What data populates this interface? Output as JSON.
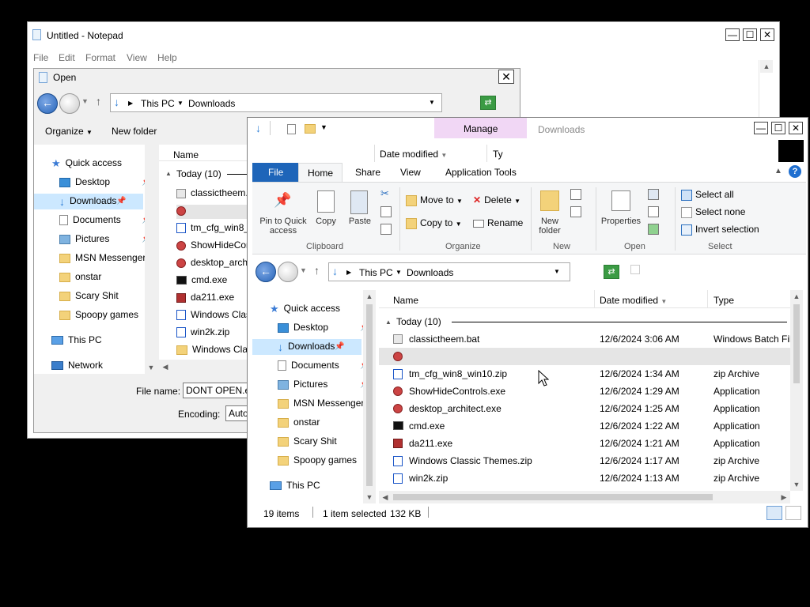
{
  "notepad": {
    "title": "Untitled - Notepad",
    "menu": [
      "File",
      "Edit",
      "Format",
      "View",
      "Help"
    ],
    "controls": {
      "minimize": "—",
      "maximize": "☐",
      "close": "✕"
    }
  },
  "open_dialog": {
    "title": "Open",
    "close": "✕",
    "path": [
      "This PC",
      "Downloads"
    ],
    "toolbar": {
      "organize": "Organize",
      "new_folder": "New folder"
    },
    "nav": [
      {
        "label": "Quick access",
        "icon": "star-icon"
      },
      {
        "label": "Desktop",
        "icon": "desktop-icon",
        "pin": true
      },
      {
        "label": "Downloads",
        "icon": "download-icon",
        "pin": true
      },
      {
        "label": "Documents",
        "icon": "documents-icon",
        "pin": true
      },
      {
        "label": "Pictures",
        "icon": "pictures-icon",
        "pin": true
      },
      {
        "label": "MSN Messenger",
        "icon": "folder-icon"
      },
      {
        "label": "onstar",
        "icon": "folder-icon"
      },
      {
        "label": "Scary Shit",
        "icon": "folder-icon"
      },
      {
        "label": "Spoopy games",
        "icon": "folder-icon"
      },
      {
        "label": "This PC",
        "icon": "computer-icon"
      },
      {
        "label": "Network",
        "icon": "network-icon"
      }
    ],
    "column_name": "Name",
    "group": "Today (10)",
    "files": [
      "classictheem.",
      "",
      "tm_cfg_win8_",
      "ShowHideCont",
      "desktop_arch",
      "cmd.exe",
      "da211.exe",
      "Windows Clas",
      "win2k.zip",
      "Windows Clas"
    ],
    "file_name_label": "File name:",
    "file_name_value": "DONT OPEN.ex",
    "encoding_label": "Encoding:",
    "encoding_value": "Auto"
  },
  "explorer": {
    "manage_tab": "Manage",
    "title": "Downloads",
    "controls": {
      "minimize": "—",
      "maximize": "☐",
      "close": "✕"
    },
    "behind_cols": {
      "date": "Date modified",
      "type": "Ty"
    },
    "tabs": [
      "File",
      "Home",
      "Share",
      "View",
      "Application Tools"
    ],
    "ribbon": {
      "clipboard": {
        "pin": "Pin to Quick access",
        "copy": "Copy",
        "paste": "Paste",
        "label": "Clipboard"
      },
      "organize": {
        "move_to": "Move to",
        "copy_to": "Copy to",
        "delete": "Delete",
        "rename": "Rename",
        "label": "Organize"
      },
      "new": {
        "new_folder": "New folder",
        "label": "New"
      },
      "open": {
        "properties": "Properties",
        "label": "Open"
      },
      "select": {
        "select_all": "Select all",
        "select_none": "Select none",
        "invert": "Invert selection",
        "label": "Select"
      }
    },
    "path": [
      "This PC",
      "Downloads"
    ],
    "nav": [
      {
        "label": "Quick access",
        "icon": "star-icon"
      },
      {
        "label": "Desktop",
        "icon": "desktop-icon",
        "pin": true
      },
      {
        "label": "Downloads",
        "icon": "download-icon",
        "pin": true
      },
      {
        "label": "Documents",
        "icon": "documents-icon",
        "pin": true
      },
      {
        "label": "Pictures",
        "icon": "pictures-icon",
        "pin": true
      },
      {
        "label": "MSN Messenger",
        "icon": "folder-icon"
      },
      {
        "label": "onstar",
        "icon": "folder-icon"
      },
      {
        "label": "Scary Shit",
        "icon": "folder-icon"
      },
      {
        "label": "Spoopy games",
        "icon": "folder-icon"
      },
      {
        "label": "This PC",
        "icon": "computer-icon"
      }
    ],
    "columns": {
      "name": "Name",
      "date": "Date modified",
      "type": "Type"
    },
    "group": "Today (10)",
    "files": [
      {
        "name": "classictheem.bat",
        "date": "12/6/2024 3:06 AM",
        "type": "Windows Batch Fil",
        "icon": "batch-file-icon"
      },
      {
        "name": "",
        "date": "",
        "type": "",
        "icon": "app-icon",
        "selected": true
      },
      {
        "name": "tm_cfg_win8_win10.zip",
        "date": "12/6/2024 1:34 AM",
        "type": "zip Archive",
        "icon": "zip-icon"
      },
      {
        "name": "ShowHideControls.exe",
        "date": "12/6/2024 1:29 AM",
        "type": "Application",
        "icon": "app-icon"
      },
      {
        "name": "desktop_architect.exe",
        "date": "12/6/2024 1:25 AM",
        "type": "Application",
        "icon": "app-icon"
      },
      {
        "name": "cmd.exe",
        "date": "12/6/2024 1:22 AM",
        "type": "Application",
        "icon": "cmd-icon"
      },
      {
        "name": "da211.exe",
        "date": "12/6/2024 1:21 AM",
        "type": "Application",
        "icon": "installer-icon"
      },
      {
        "name": "Windows Classic Themes.zip",
        "date": "12/6/2024 1:17 AM",
        "type": "zip Archive",
        "icon": "zip-icon"
      },
      {
        "name": "win2k.zip",
        "date": "12/6/2024 1:13 AM",
        "type": "zip Archive",
        "icon": "zip-icon"
      }
    ],
    "status": {
      "count": "19 items",
      "selected": "1 item selected",
      "size": "132 KB"
    }
  }
}
